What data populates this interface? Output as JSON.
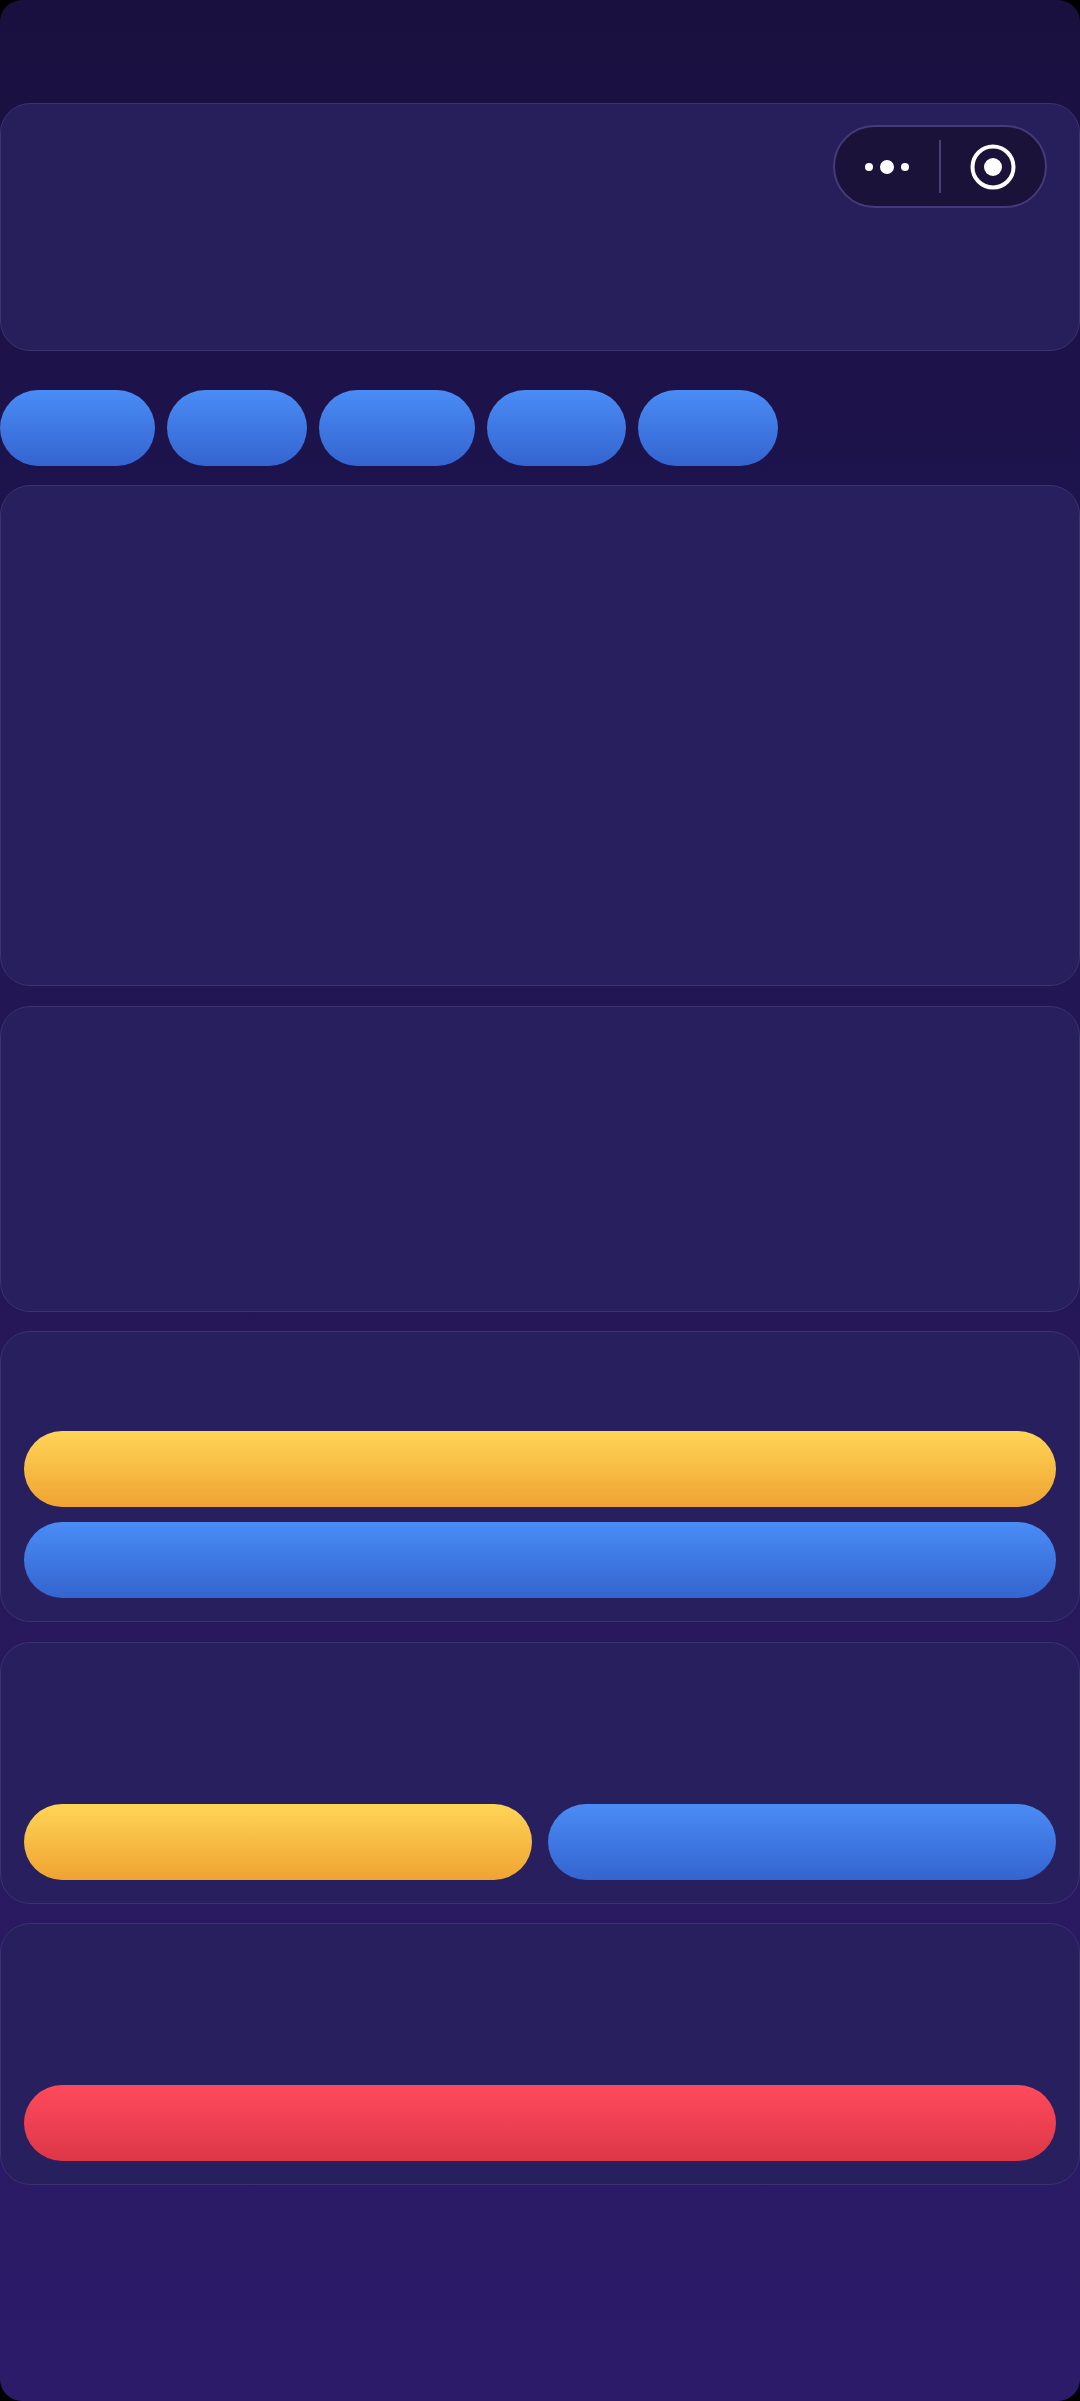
{
  "header": {
    "capsule": true
  },
  "chips": [
    {
      "kind": "primary"
    },
    {
      "kind": "primary"
    },
    {
      "kind": "primary"
    },
    {
      "kind": "primary"
    },
    {
      "kind": "primary"
    }
  ],
  "cards": [
    {
      "kind": "blank"
    },
    {
      "kind": "blank"
    },
    {
      "kind": "stacked",
      "buttons": [
        {
          "kind": "warning"
        },
        {
          "kind": "primary"
        }
      ]
    },
    {
      "kind": "row",
      "buttons": [
        {
          "kind": "warning"
        },
        {
          "kind": "primary"
        }
      ]
    },
    {
      "kind": "stacked",
      "buttons": [
        {
          "kind": "danger"
        }
      ]
    }
  ]
}
